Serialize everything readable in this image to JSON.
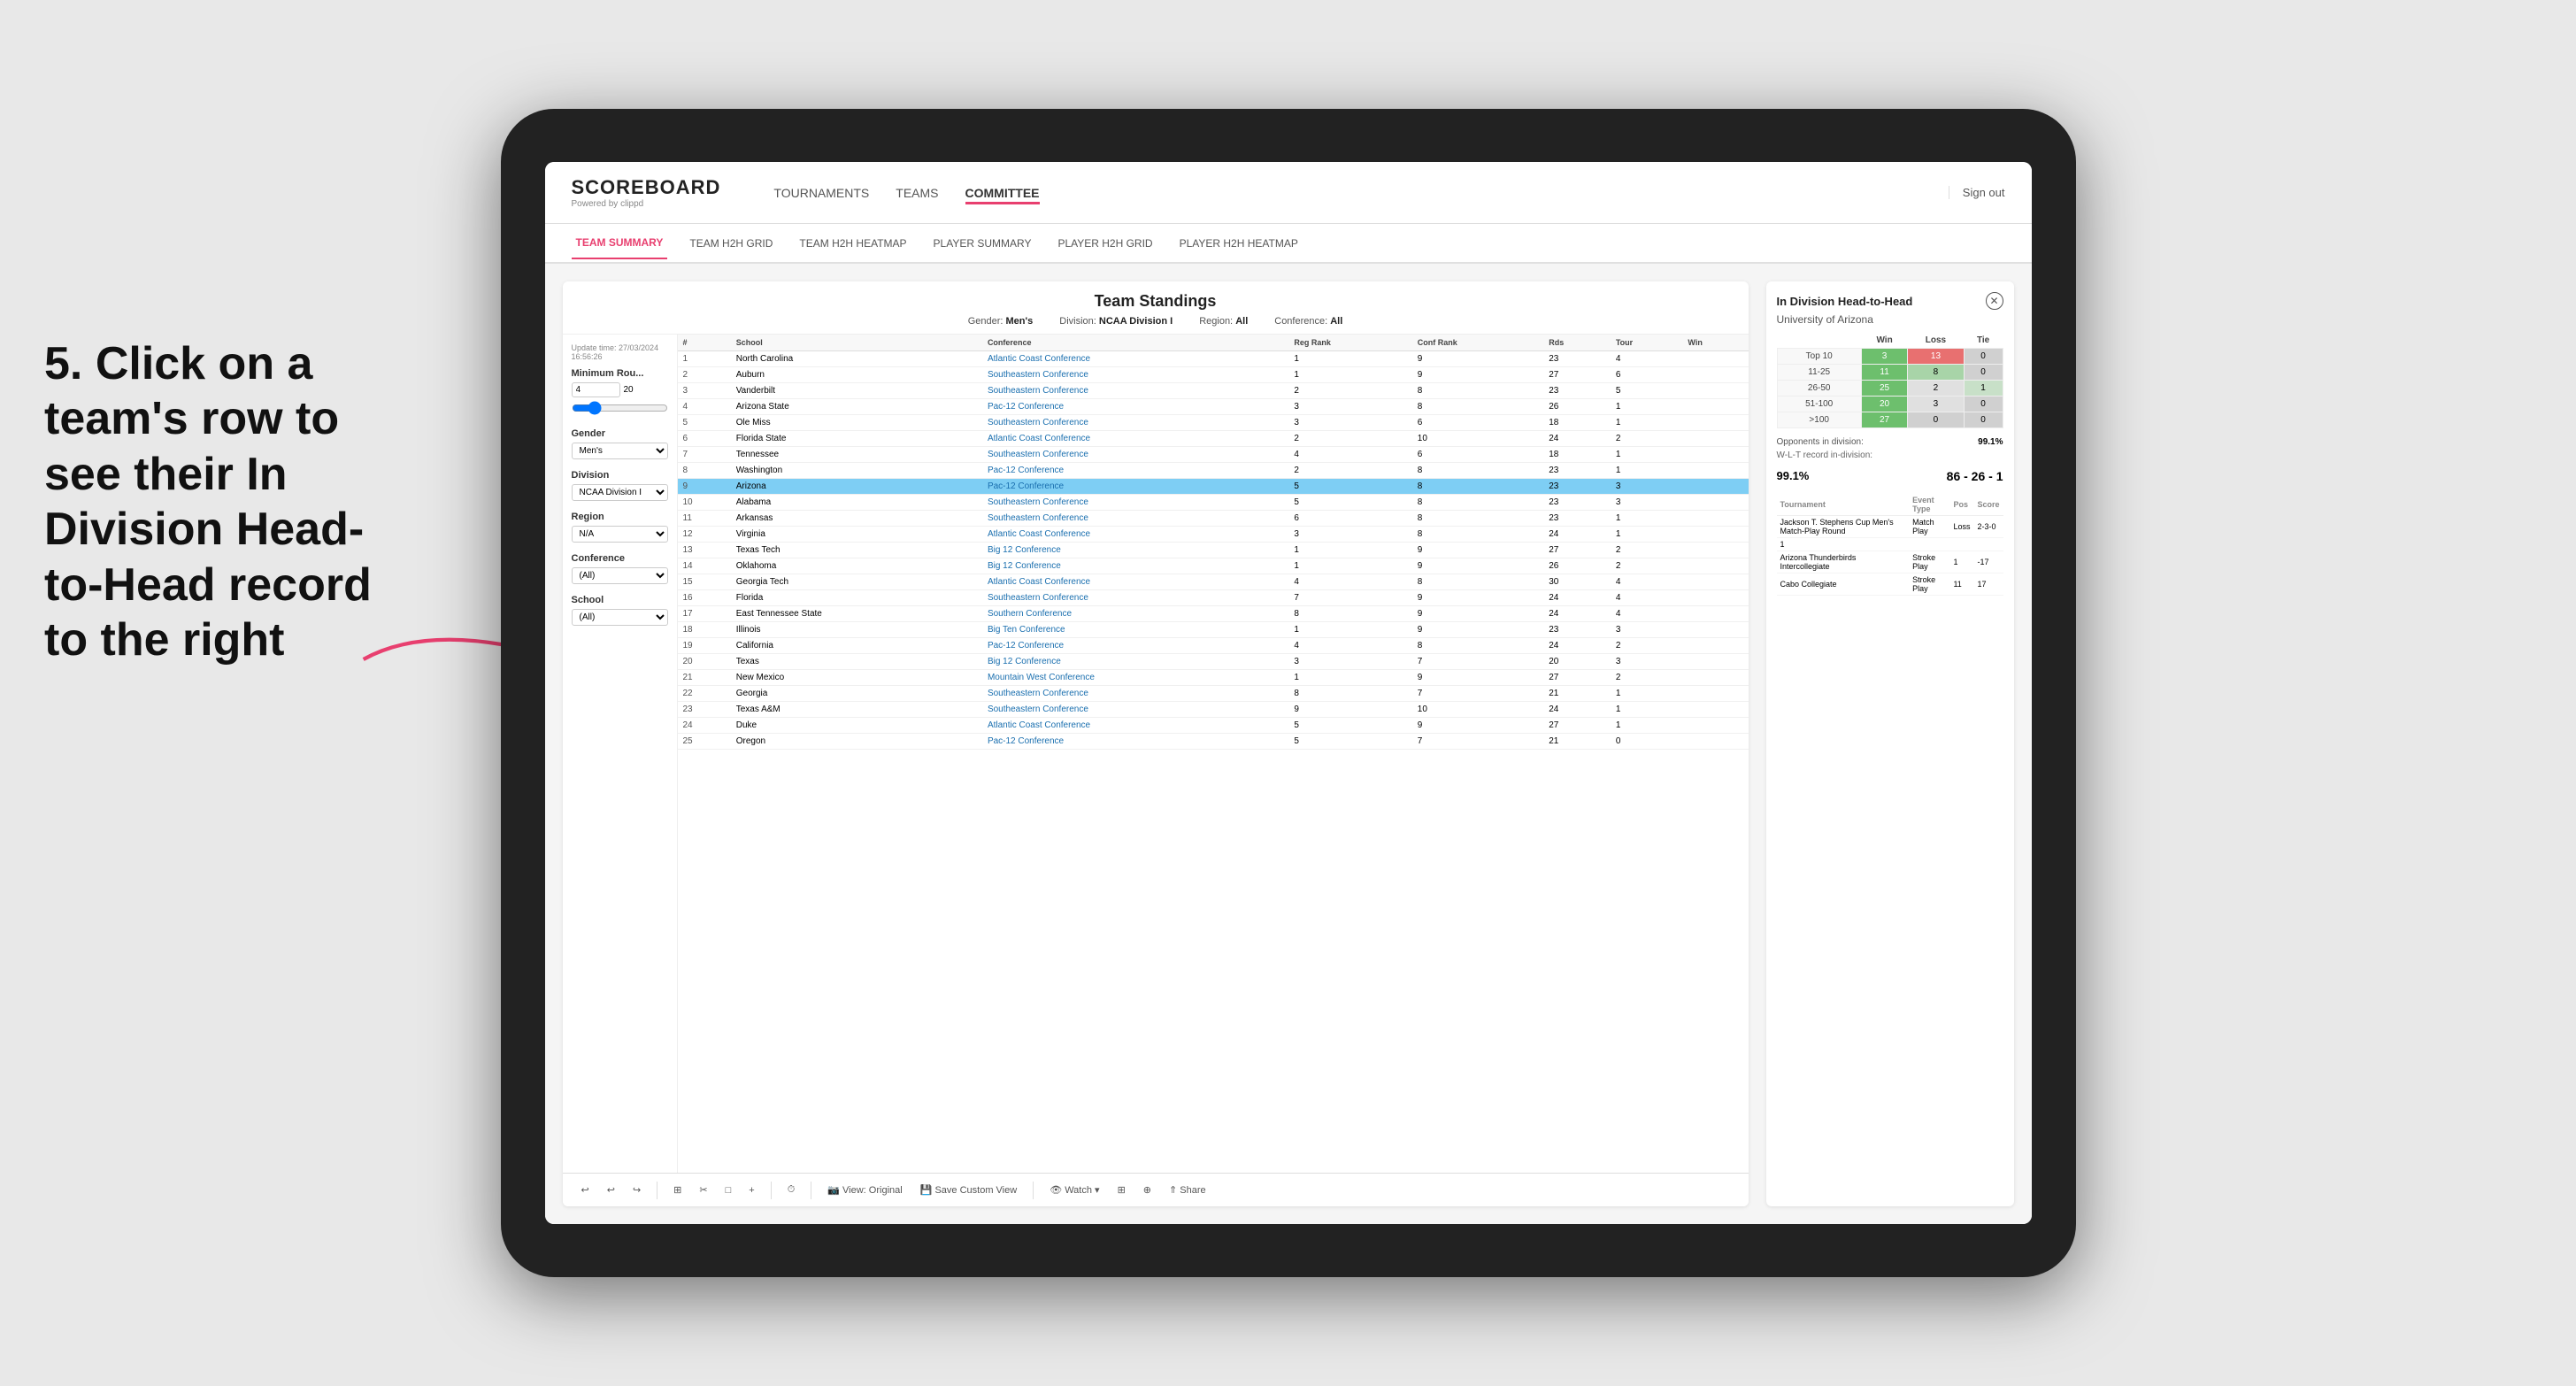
{
  "annotation": {
    "text": "5. Click on a team's row to see their In Division Head-to-Head record to the right"
  },
  "app": {
    "logo": "SCOREBOARD",
    "logo_sub": "Powered by clippd",
    "sign_out": "Sign out"
  },
  "nav": {
    "items": [
      {
        "label": "TOURNAMENTS",
        "active": false
      },
      {
        "label": "TEAMS",
        "active": false
      },
      {
        "label": "COMMITTEE",
        "active": true
      }
    ]
  },
  "sub_nav": {
    "items": [
      {
        "label": "TEAM SUMMARY",
        "active": true
      },
      {
        "label": "TEAM H2H GRID",
        "active": false
      },
      {
        "label": "TEAM H2H HEATMAP",
        "active": false
      },
      {
        "label": "PLAYER SUMMARY",
        "active": false
      },
      {
        "label": "PLAYER H2H GRID",
        "active": false
      },
      {
        "label": "PLAYER H2H HEATMAP",
        "active": false
      }
    ]
  },
  "panel": {
    "title": "Team Standings",
    "update_time": "Update time: 27/03/2024 16:56:26",
    "meta": {
      "gender": "Men's",
      "division": "NCAA Division I",
      "region": "All",
      "conference": "All"
    },
    "filters": {
      "min_rounds_label": "Minimum Rou...",
      "min_rounds_value": "4",
      "min_rounds_max": "20",
      "gender_label": "Gender",
      "gender_value": "Men's",
      "division_label": "Division",
      "division_value": "NCAA Division I",
      "region_label": "Region",
      "region_value": "N/A",
      "conference_label": "Conference",
      "conference_value": "(All)",
      "school_label": "School",
      "school_value": "(All)"
    },
    "table": {
      "headers": [
        "#",
        "School",
        "Conference",
        "Reg Rank",
        "Conf Rank",
        "Rds",
        "Tour",
        "Win"
      ],
      "rows": [
        {
          "rank": 1,
          "school": "North Carolina",
          "conference": "Atlantic Coast Conference",
          "reg_rank": 1,
          "conf_rank": 9,
          "rds": 23,
          "tour": 4,
          "win": ""
        },
        {
          "rank": 2,
          "school": "Auburn",
          "conference": "Southeastern Conference",
          "reg_rank": 1,
          "conf_rank": 9,
          "rds": 27,
          "tour": 6,
          "win": ""
        },
        {
          "rank": 3,
          "school": "Vanderbilt",
          "conference": "Southeastern Conference",
          "reg_rank": 2,
          "conf_rank": 8,
          "rds": 23,
          "tour": 5,
          "win": ""
        },
        {
          "rank": 4,
          "school": "Arizona State",
          "conference": "Pac-12 Conference",
          "reg_rank": 3,
          "conf_rank": 8,
          "rds": 26,
          "tour": 1,
          "win": ""
        },
        {
          "rank": 5,
          "school": "Ole Miss",
          "conference": "Southeastern Conference",
          "reg_rank": 3,
          "conf_rank": 6,
          "rds": 18,
          "tour": 1,
          "win": ""
        },
        {
          "rank": 6,
          "school": "Florida State",
          "conference": "Atlantic Coast Conference",
          "reg_rank": 2,
          "conf_rank": 10,
          "rds": 24,
          "tour": 2,
          "win": ""
        },
        {
          "rank": 7,
          "school": "Tennessee",
          "conference": "Southeastern Conference",
          "reg_rank": 4,
          "conf_rank": 6,
          "rds": 18,
          "tour": 1,
          "win": ""
        },
        {
          "rank": 8,
          "school": "Washington",
          "conference": "Pac-12 Conference",
          "reg_rank": 2,
          "conf_rank": 8,
          "rds": 23,
          "tour": 1,
          "win": ""
        },
        {
          "rank": 9,
          "school": "Arizona",
          "conference": "Pac-12 Conference",
          "reg_rank": 5,
          "conf_rank": 8,
          "rds": 23,
          "tour": 3,
          "win": "",
          "highlighted": true
        },
        {
          "rank": 10,
          "school": "Alabama",
          "conference": "Southeastern Conference",
          "reg_rank": 5,
          "conf_rank": 8,
          "rds": 23,
          "tour": 3,
          "win": ""
        },
        {
          "rank": 11,
          "school": "Arkansas",
          "conference": "Southeastern Conference",
          "reg_rank": 6,
          "conf_rank": 8,
          "rds": 23,
          "tour": 1,
          "win": ""
        },
        {
          "rank": 12,
          "school": "Virginia",
          "conference": "Atlantic Coast Conference",
          "reg_rank": 3,
          "conf_rank": 8,
          "rds": 24,
          "tour": 1,
          "win": ""
        },
        {
          "rank": 13,
          "school": "Texas Tech",
          "conference": "Big 12 Conference",
          "reg_rank": 1,
          "conf_rank": 9,
          "rds": 27,
          "tour": 2,
          "win": ""
        },
        {
          "rank": 14,
          "school": "Oklahoma",
          "conference": "Big 12 Conference",
          "reg_rank": 1,
          "conf_rank": 9,
          "rds": 26,
          "tour": 2,
          "win": ""
        },
        {
          "rank": 15,
          "school": "Georgia Tech",
          "conference": "Atlantic Coast Conference",
          "reg_rank": 4,
          "conf_rank": 8,
          "rds": 30,
          "tour": 4,
          "win": ""
        },
        {
          "rank": 16,
          "school": "Florida",
          "conference": "Southeastern Conference",
          "reg_rank": 7,
          "conf_rank": 9,
          "rds": 24,
          "tour": 4,
          "win": ""
        },
        {
          "rank": 17,
          "school": "East Tennessee State",
          "conference": "Southern Conference",
          "reg_rank": 8,
          "conf_rank": 9,
          "rds": 24,
          "tour": 4,
          "win": ""
        },
        {
          "rank": 18,
          "school": "Illinois",
          "conference": "Big Ten Conference",
          "reg_rank": 1,
          "conf_rank": 9,
          "rds": 23,
          "tour": 3,
          "win": ""
        },
        {
          "rank": 19,
          "school": "California",
          "conference": "Pac-12 Conference",
          "reg_rank": 4,
          "conf_rank": 8,
          "rds": 24,
          "tour": 2,
          "win": ""
        },
        {
          "rank": 20,
          "school": "Texas",
          "conference": "Big 12 Conference",
          "reg_rank": 3,
          "conf_rank": 7,
          "rds": 20,
          "tour": 3,
          "win": ""
        },
        {
          "rank": 21,
          "school": "New Mexico",
          "conference": "Mountain West Conference",
          "reg_rank": 1,
          "conf_rank": 9,
          "rds": 27,
          "tour": 2,
          "win": ""
        },
        {
          "rank": 22,
          "school": "Georgia",
          "conference": "Southeastern Conference",
          "reg_rank": 8,
          "conf_rank": 7,
          "rds": 21,
          "tour": 1,
          "win": ""
        },
        {
          "rank": 23,
          "school": "Texas A&M",
          "conference": "Southeastern Conference",
          "reg_rank": 9,
          "conf_rank": 10,
          "rds": 24,
          "tour": 1,
          "win": ""
        },
        {
          "rank": 24,
          "school": "Duke",
          "conference": "Atlantic Coast Conference",
          "reg_rank": 5,
          "conf_rank": 9,
          "rds": 27,
          "tour": 1,
          "win": ""
        },
        {
          "rank": 25,
          "school": "Oregon",
          "conference": "Pac-12 Conference",
          "reg_rank": 5,
          "conf_rank": 7,
          "rds": 21,
          "tour": 0,
          "win": ""
        }
      ]
    }
  },
  "h2h": {
    "title": "In Division Head-to-Head",
    "team": "University of Arizona",
    "columns": [
      "Win",
      "Loss",
      "Tie"
    ],
    "rows": [
      {
        "label": "Top 10",
        "win": 3,
        "loss": 13,
        "tie": 0,
        "win_color": "green",
        "loss_color": "red",
        "tie_color": "grey"
      },
      {
        "label": "11-25",
        "win": 11,
        "loss": 8,
        "tie": 0,
        "win_color": "green",
        "loss_color": "green_light",
        "tie_color": "grey"
      },
      {
        "label": "26-50",
        "win": 25,
        "loss": 2,
        "tie": 1,
        "win_color": "green",
        "loss_color": "grey_light",
        "tie_color": "grey"
      },
      {
        "label": "51-100",
        "win": 20,
        "loss": 3,
        "tie": 0,
        "win_color": "green",
        "loss_color": "grey_light",
        "tie_color": "grey"
      },
      {
        "label": ">100",
        "win": 27,
        "loss": 0,
        "tie": 0,
        "win_color": "green",
        "loss_color": "grey",
        "tie_color": "grey"
      }
    ],
    "opponents_label": "Opponents in division:",
    "opponents_value": "99.1%",
    "record_label": "W-L-T record in-division:",
    "record_value": "86 - 26 - 1",
    "tournaments": {
      "headers": [
        "Tournament",
        "Event Type",
        "Pos",
        "Score"
      ],
      "rows": [
        {
          "tournament": "Jackson T. Stephens Cup Men's Match-Play Round",
          "event_type": "Match Play",
          "pos": "Loss",
          "score": "2-3-0"
        },
        {
          "tournament": "1",
          "event_type": "",
          "pos": "",
          "score": ""
        },
        {
          "tournament": "Arizona Thunderbirds Intercollegiate",
          "event_type": "Stroke Play",
          "pos": "1",
          "score": "-17"
        },
        {
          "tournament": "Cabo Collegiate",
          "event_type": "Stroke Play",
          "pos": "11",
          "score": "17"
        }
      ]
    }
  },
  "toolbar": {
    "buttons": [
      "↩",
      "↩",
      "↪",
      "⊞",
      "✂",
      "□",
      "+",
      "⏱",
      "View: Original",
      "Save Custom View",
      "Watch",
      "⊞",
      "⊕",
      "Share"
    ]
  }
}
